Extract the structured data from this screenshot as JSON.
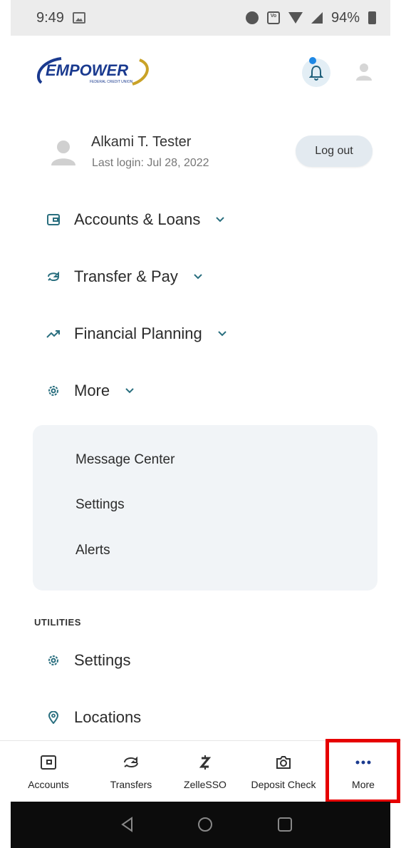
{
  "status_bar": {
    "time": "9:49",
    "battery": "94%"
  },
  "header": {
    "logo_text": "EMPOWER",
    "logo_subtext": "FEDERAL CREDIT UNION",
    "brand_color": "#1a3a8f",
    "accent_color": "#c9a227"
  },
  "user": {
    "name": "Alkami T. Tester",
    "last_login": "Last login: Jul 28, 2022",
    "logout_label": "Log out"
  },
  "menu": {
    "items": [
      {
        "label": "Accounts & Loans",
        "icon": "wallet-icon"
      },
      {
        "label": "Transfer & Pay",
        "icon": "transfer-icon"
      },
      {
        "label": "Financial Planning",
        "icon": "trend-icon"
      },
      {
        "label": "More",
        "icon": "gear-icon"
      }
    ],
    "more_submenu": [
      "Message Center",
      "Settings",
      "Alerts"
    ]
  },
  "utilities": {
    "section_label": "UTILITIES",
    "items": [
      {
        "label": "Settings",
        "icon": "gear-icon"
      },
      {
        "label": "Locations",
        "icon": "location-pin-icon"
      }
    ]
  },
  "tabbar": {
    "tabs": [
      {
        "label": "Accounts",
        "icon": "wallet-icon"
      },
      {
        "label": "Transfers",
        "icon": "transfer-icon"
      },
      {
        "label": "ZelleSSO",
        "icon": "zelle-icon"
      },
      {
        "label": "Deposit Check",
        "icon": "camera-icon"
      },
      {
        "label": "More",
        "icon": "more-dots-icon"
      }
    ],
    "highlight_color": "#e60000"
  }
}
